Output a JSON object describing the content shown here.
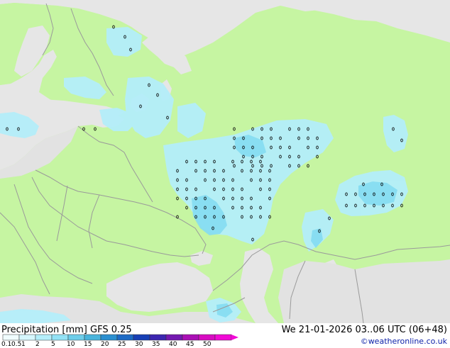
{
  "map": {
    "colors": {
      "sea": "#e6e6e6",
      "land": "#c6f5a2",
      "no_data": "#e2e2e2",
      "precip_light": "#b4eefa",
      "precip_mid": "#84dcf2",
      "border": "#9a9a9a",
      "dot": "#000000"
    }
  },
  "footer": {
    "title": "Precipitation [mm]  GFS 0.25",
    "datetime": "We 21-01-2026 03..06 UTC (06+48)",
    "credit": "©weatheronline.co.uk"
  },
  "legend": {
    "ticks": [
      "0.1",
      "0.5",
      "1",
      "2",
      "5",
      "10",
      "15",
      "20",
      "25",
      "30",
      "35",
      "40",
      "45",
      "50"
    ],
    "colors": [
      "#f0fcfe",
      "#d6f6fc",
      "#b4eefa",
      "#93e2f5",
      "#6ecde9",
      "#4ab4dc",
      "#2b8fd0",
      "#1c6ac5",
      "#173fb5",
      "#3c26b0",
      "#7419b0",
      "#aa10b5",
      "#d80cc2",
      "#f10ad6"
    ]
  }
}
